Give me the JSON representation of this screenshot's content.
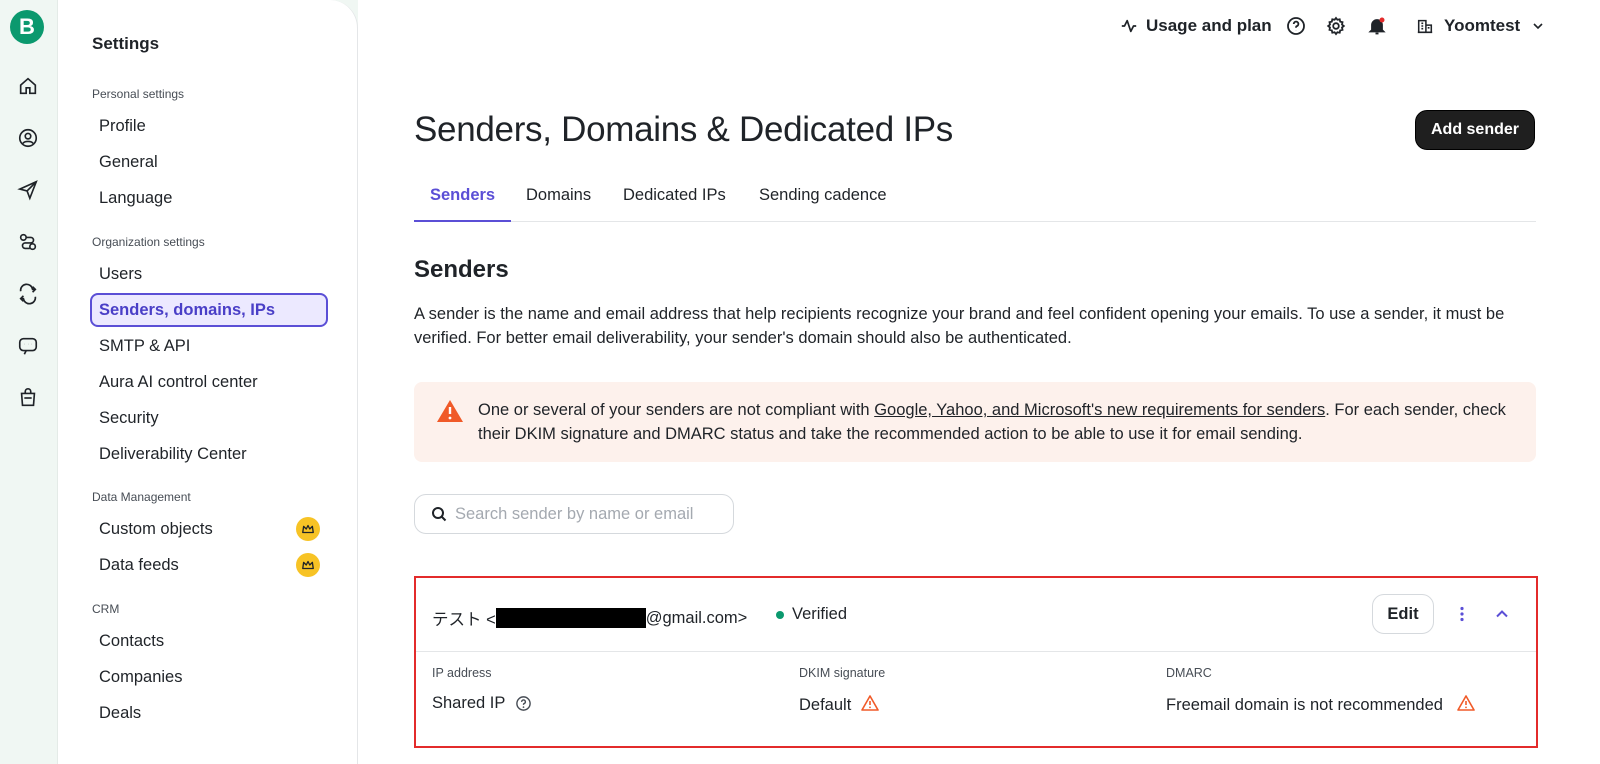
{
  "rail": {
    "logo_letter": "B",
    "icons": [
      "home-icon",
      "contacts-icon",
      "campaigns-icon",
      "automations-icon",
      "conversations-icon",
      "chat-icon",
      "commerce-icon"
    ]
  },
  "sidebar": {
    "title": "Settings",
    "sections": [
      {
        "label": "Personal settings",
        "items": [
          "Profile",
          "General",
          "Language"
        ]
      },
      {
        "label": "Organization settings",
        "items": [
          "Users",
          "Senders, domains, IPs",
          "SMTP & API",
          "Aura AI control center",
          "Security",
          "Deliverability Center"
        ]
      },
      {
        "label": "Data Management",
        "items": [
          "Custom objects",
          "Data feeds"
        ]
      },
      {
        "label": "CRM",
        "items": [
          "Contacts",
          "Companies",
          "Deals"
        ]
      }
    ],
    "active_item": "Senders, domains, IPs",
    "premium_badge_color": "#f7c325"
  },
  "topbar": {
    "usage_label": "Usage and plan",
    "org_name": "Yoomtest"
  },
  "page": {
    "title": "Senders, Domains & Dedicated IPs",
    "add_button": "Add sender",
    "tabs": [
      "Senders",
      "Domains",
      "Dedicated IPs",
      "Sending cadence"
    ],
    "active_tab": "Senders",
    "accent_color": "#5b4fd6"
  },
  "senders": {
    "heading": "Senders",
    "description": "A sender is the name and email address that help recipients recognize your brand and feel confident opening your emails. To use a sender, it must be verified. For better email deliverability, your sender's domain should also be authenticated.",
    "alert": {
      "text_before": "One or several of your senders are not compliant with ",
      "link": "Google, Yahoo, and Microsoft's new requirements for senders",
      "text_after": ". For each sender, check their DKIM signature and DMARC status and take the recommended action to be able to use it for email sending.",
      "icon": "warning-icon",
      "color": "#f05a28"
    },
    "search_placeholder": "Search sender by name or email",
    "sender": {
      "name_prefix": "テスト <",
      "email_suffix": "@gmail.com>",
      "status": "Verified",
      "status_color": "#0b996e",
      "edit_label": "Edit",
      "ip_label": "IP address",
      "ip_value": "Shared IP",
      "dkim_label": "DKIM signature",
      "dkim_value": "Default",
      "dmarc_label": "DMARC",
      "dmarc_value": "Freemail domain is not recommended"
    }
  }
}
